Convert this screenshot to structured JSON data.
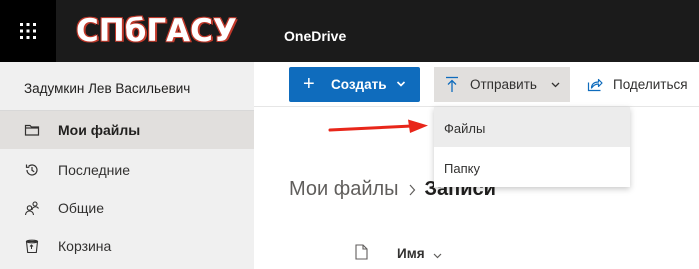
{
  "header": {
    "logo_text": "СПбГАСУ",
    "app_title": "OneDrive"
  },
  "sidebar": {
    "user_name": "Задумкин Лев Васильевич",
    "items": [
      {
        "label": "Мои файлы",
        "icon": "folder-icon",
        "active": true
      },
      {
        "label": "Последние",
        "icon": "history-icon",
        "active": false
      },
      {
        "label": "Общие",
        "icon": "people-icon",
        "active": false
      },
      {
        "label": "Корзина",
        "icon": "recycle-bin-icon",
        "active": false
      }
    ]
  },
  "toolbar": {
    "create_label": "Создать",
    "upload_label": "Отправить",
    "share_label": "Поделиться"
  },
  "upload_menu": {
    "items": [
      {
        "label": "Файлы",
        "highlighted": true
      },
      {
        "label": "Папку",
        "highlighted": false
      }
    ]
  },
  "breadcrumb": {
    "parent": "Мои файлы",
    "current": "Записи"
  },
  "list": {
    "column_name": "Имя"
  },
  "colors": {
    "accent": "#0f6cbd",
    "topbar": "#1b1b1b",
    "arrow": "#e8261a"
  }
}
